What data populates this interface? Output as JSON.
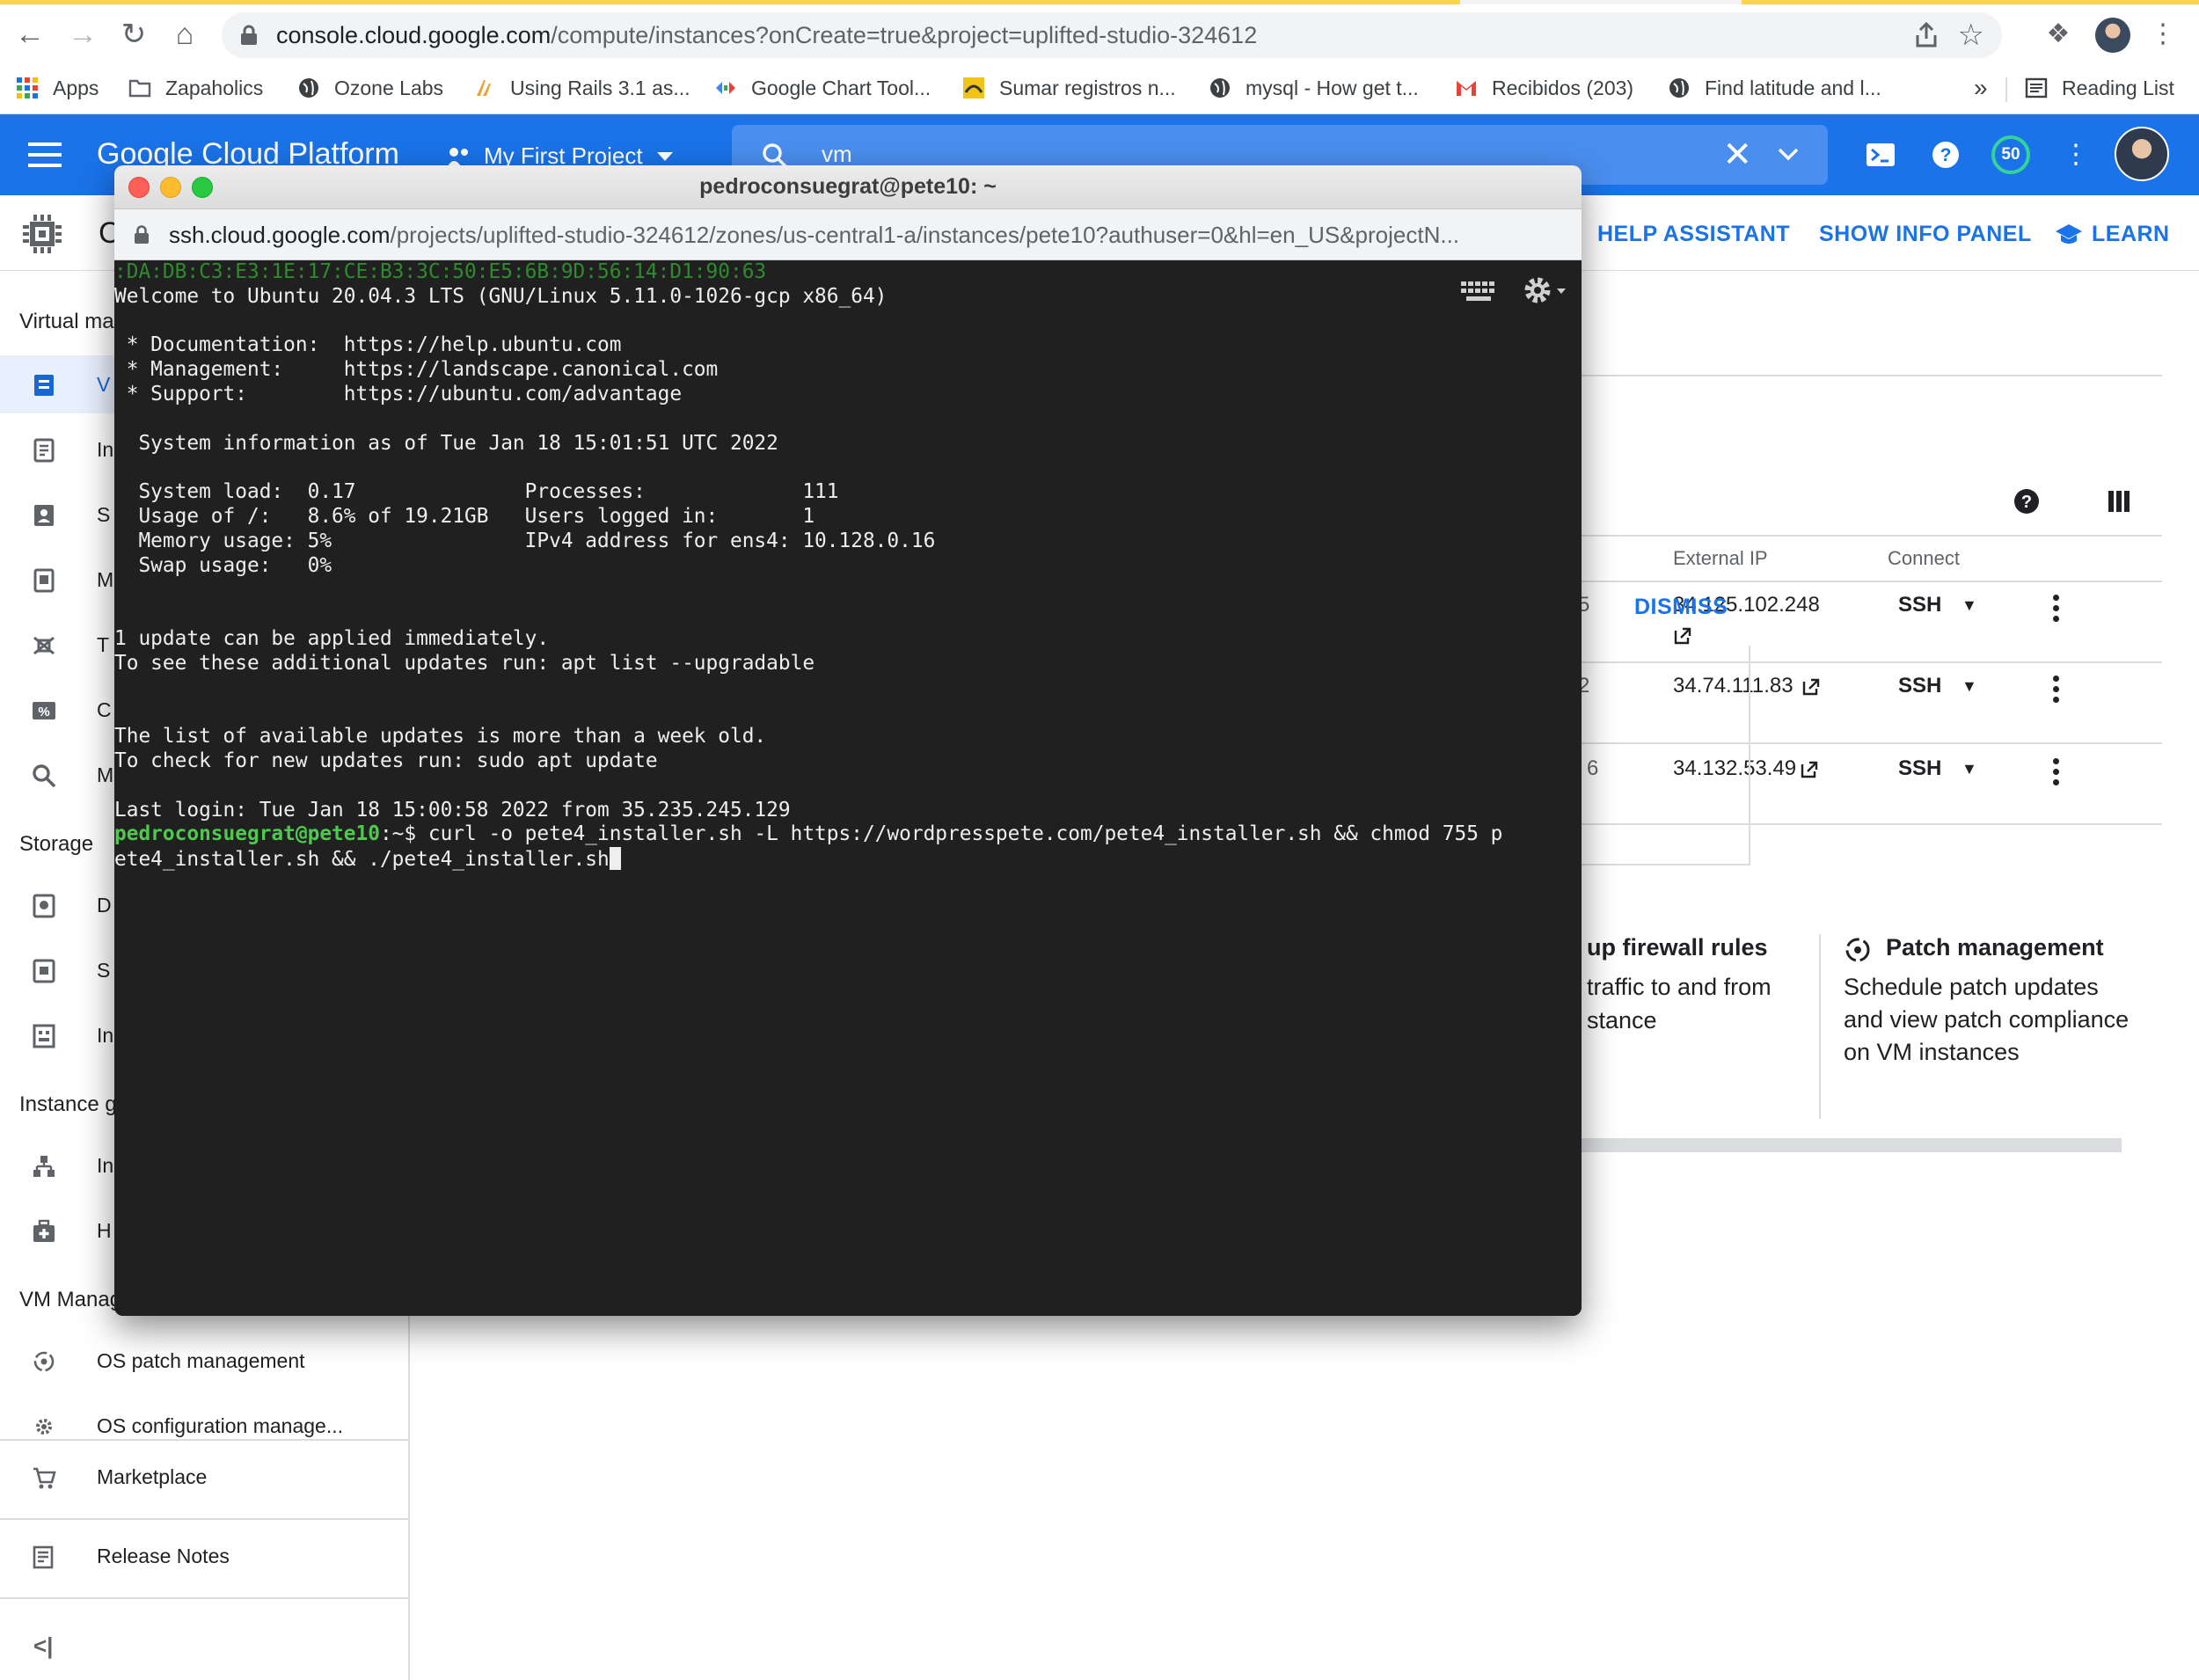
{
  "browser": {
    "url_host": "console.cloud.google.com",
    "url_path": "/compute/instances?onCreate=true&project=uplifted-studio-324612",
    "bookmarks": [
      {
        "label": "Apps",
        "icon": "apps-grid-icon"
      },
      {
        "label": "Zapaholics",
        "icon": "folder-icon"
      },
      {
        "label": "Ozone Labs",
        "icon": "globe-icon"
      },
      {
        "label": "Using Rails 3.1 as...",
        "icon": "site-icon"
      },
      {
        "label": "Google Chart Tool...",
        "icon": "chart-tools-icon"
      },
      {
        "label": "Sumar registros n...",
        "icon": "site-icon"
      },
      {
        "label": "mysql - How get t...",
        "icon": "globe-icon"
      },
      {
        "label": "Recibidos (203)",
        "icon": "gmail-icon"
      },
      {
        "label": "Find latitude and l...",
        "icon": "globe-icon"
      }
    ],
    "more_bookmarks": "»",
    "reading_list": "Reading List"
  },
  "gcp": {
    "title": "Google Cloud Platform",
    "project": "My First Project",
    "search_query": "vm",
    "notifications_badge": "50",
    "subheader_title_fragment": "C",
    "links": {
      "help": "HELP ASSISTANT",
      "info": "SHOW INFO PANEL",
      "learn": "LEARN"
    }
  },
  "sidebar": {
    "sections": [
      "Virtual ma",
      "Storage",
      "Instance g",
      "VM Manag"
    ],
    "frag_items": [
      "V",
      "In",
      "S",
      "M",
      "T",
      "C",
      "M",
      "D",
      "S",
      "In",
      "In",
      "H"
    ],
    "items": [
      {
        "label": "OS patch management"
      },
      {
        "label": "OS configuration manage..."
      },
      {
        "label": "Marketplace"
      },
      {
        "label": "Release Notes"
      }
    ],
    "collapse": "<|"
  },
  "table": {
    "headers": {
      "external_ip": "External IP",
      "connect": "Connect"
    },
    "rows": [
      {
        "frag": "5",
        "external_ip": "34.125.102.248",
        "connect": "SSH"
      },
      {
        "frag": "2",
        "external_ip": "34.74.111.83",
        "connect": "SSH"
      },
      {
        "frag": "6",
        "external_ip": "34.132.53.49",
        "connect": "SSH"
      }
    ]
  },
  "cards": {
    "dismiss": "DISMISS",
    "firewall": {
      "title": "up firewall rules",
      "line1": "traffic to and from",
      "line2": "stance"
    },
    "patch": {
      "title": "Patch management",
      "body": "Schedule patch updates and view patch compliance on VM instances"
    }
  },
  "ssh": {
    "window_title": "pedroconsuegrat@pete10: ~",
    "url_host": "ssh.cloud.google.com",
    "url_path": "/projects/uplifted-studio-324612/zones/us-central1-a/instances/pete10?authuser=0&hl=en_US&projectN...",
    "fingerprint": ":DA:DB:C3:E3:1E:17:CE:B3:3C:50:E5:6B:9D:56:14:D1:90:63",
    "lines": [
      "Welcome to Ubuntu 20.04.3 LTS (GNU/Linux 5.11.0-1026-gcp x86_64)",
      "",
      " * Documentation:  https://help.ubuntu.com",
      " * Management:     https://landscape.canonical.com",
      " * Support:        https://ubuntu.com/advantage",
      "",
      "  System information as of Tue Jan 18 15:01:51 UTC 2022",
      "",
      "  System load:  0.17              Processes:             111",
      "  Usage of /:   8.6% of 19.21GB   Users logged in:       1",
      "  Memory usage: 5%                IPv4 address for ens4: 10.128.0.16",
      "  Swap usage:   0%",
      "",
      "",
      "1 update can be applied immediately.",
      "To see these additional updates run: apt list --upgradable",
      "",
      "",
      "The list of available updates is more than a week old.",
      "To check for new updates run: sudo apt update",
      "",
      "Last login: Tue Jan 18 15:00:58 2022 from 35.235.245.129"
    ],
    "prompt_user": "pedroconsuegrat@pete10",
    "prompt_suffix": ":~$ ",
    "command_line1": "curl -o pete4_installer.sh -L https://wordpresspete.com/pete4_installer.sh && chmod 755 p",
    "command_line2": "ete4_installer.sh && ./pete4_installer.sh"
  },
  "colors": {
    "gcp_blue": "#1a73e8",
    "terminal_bg": "#202020",
    "prompt_green": "#4ec94e"
  }
}
